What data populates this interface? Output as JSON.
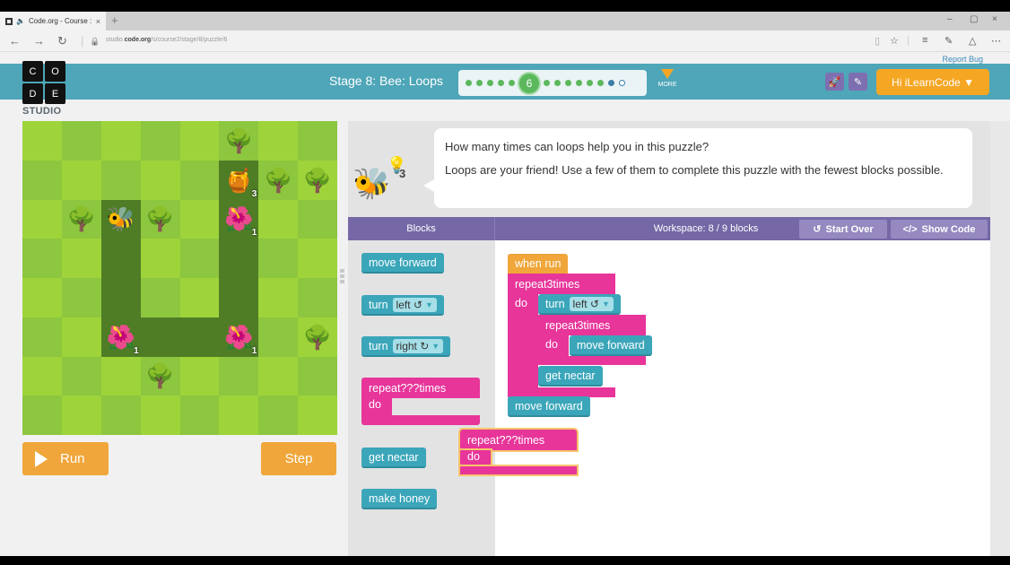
{
  "browser": {
    "tab_title": "Code.org - Course :",
    "tab_close": "×",
    "new_tab": "+",
    "url_prefix": "studio.",
    "url_domain": "code.org",
    "url_path": "/s/course2/stage/8/puzzle/6",
    "window_controls": [
      "–",
      "▢",
      "×"
    ],
    "nav": {
      "back": "←",
      "forward": "→",
      "refresh": "↻",
      "lock": "🔒"
    },
    "toolbar_icons": [
      "reading-view-icon",
      "favorite-star-icon",
      "hub-icon",
      "web-note-icon",
      "share-icon",
      "more-icon"
    ]
  },
  "header": {
    "report_bug": "Report Bug",
    "logo_letters": [
      "C",
      "O",
      "D",
      "E"
    ],
    "studio_label": "STUDIO",
    "stage_title": "Stage 8: Bee: Loops",
    "progress": {
      "current_level": "6",
      "levels_before": 5,
      "levels_after": 6,
      "trailing": [
        "completed-blue",
        "unattempted"
      ]
    },
    "more_label": "MORE",
    "user_button": "Hi iLearnCode ▼"
  },
  "maze": {
    "rows": 8,
    "cols": 8,
    "cells": [
      [
        "l",
        "d",
        "l",
        "d",
        "l",
        "tree",
        "l",
        "d"
      ],
      [
        "d",
        "l",
        "d",
        "l",
        "d",
        "honey:3",
        "tree",
        "tree"
      ],
      [
        "l",
        "tree",
        "bee",
        "tree",
        "l",
        "flower:1",
        "l",
        "d"
      ],
      [
        "d",
        "l",
        "path",
        "l",
        "d",
        "path",
        "d",
        "l"
      ],
      [
        "l",
        "d",
        "path",
        "d",
        "l",
        "path",
        "l",
        "d"
      ],
      [
        "d",
        "l",
        "flower:1",
        "path",
        "path",
        "flower:1",
        "d",
        "tree"
      ],
      [
        "l",
        "d",
        "l",
        "tree",
        "l",
        "d",
        "l",
        "d"
      ],
      [
        "d",
        "l",
        "d",
        "l",
        "d",
        "l",
        "d",
        "l"
      ]
    ]
  },
  "controls": {
    "run": "Run",
    "step": "Step"
  },
  "instructions": {
    "hint_count": "3",
    "line1": "How many times can loops help you in this puzzle?",
    "line2": "Loops are your friend! Use a few of them to complete this puzzle with the fewest blocks possible."
  },
  "workspace_header": {
    "blocks_label": "Blocks",
    "workspace_label": "Workspace: 8 / 9 blocks",
    "start_over": "Start Over",
    "show_code": "Show Code"
  },
  "toolbox": {
    "move_forward": "move forward",
    "turn_left": {
      "label": "turn",
      "value": "left ↺"
    },
    "turn_right": {
      "label": "turn",
      "value": "right ↻"
    },
    "repeat": {
      "label": "repeat",
      "value": "???",
      "suffix": "times",
      "do": "do"
    },
    "get_nectar": "get nectar",
    "make_honey": "make honey"
  },
  "program": {
    "when_run": "when run",
    "outer_repeat": {
      "label": "repeat",
      "value": "3",
      "suffix": "times",
      "do": "do"
    },
    "turn": {
      "label": "turn",
      "value": "left ↺"
    },
    "inner_repeat": {
      "label": "repeat",
      "value": "3",
      "suffix": "times",
      "do": "do"
    },
    "inner_move": "move forward",
    "get_nectar": "get nectar",
    "final_move": "move forward",
    "dragging_repeat": {
      "label": "repeat",
      "value": "???",
      "suffix": "times",
      "do": "do"
    }
  },
  "colors": {
    "header": "#4ea6b8",
    "accent_orange": "#f0a63a",
    "workspace_purple": "#7668a6",
    "block_teal": "#3ba6ba",
    "block_pink": "#e7359a",
    "level_green": "#5cb85c"
  }
}
